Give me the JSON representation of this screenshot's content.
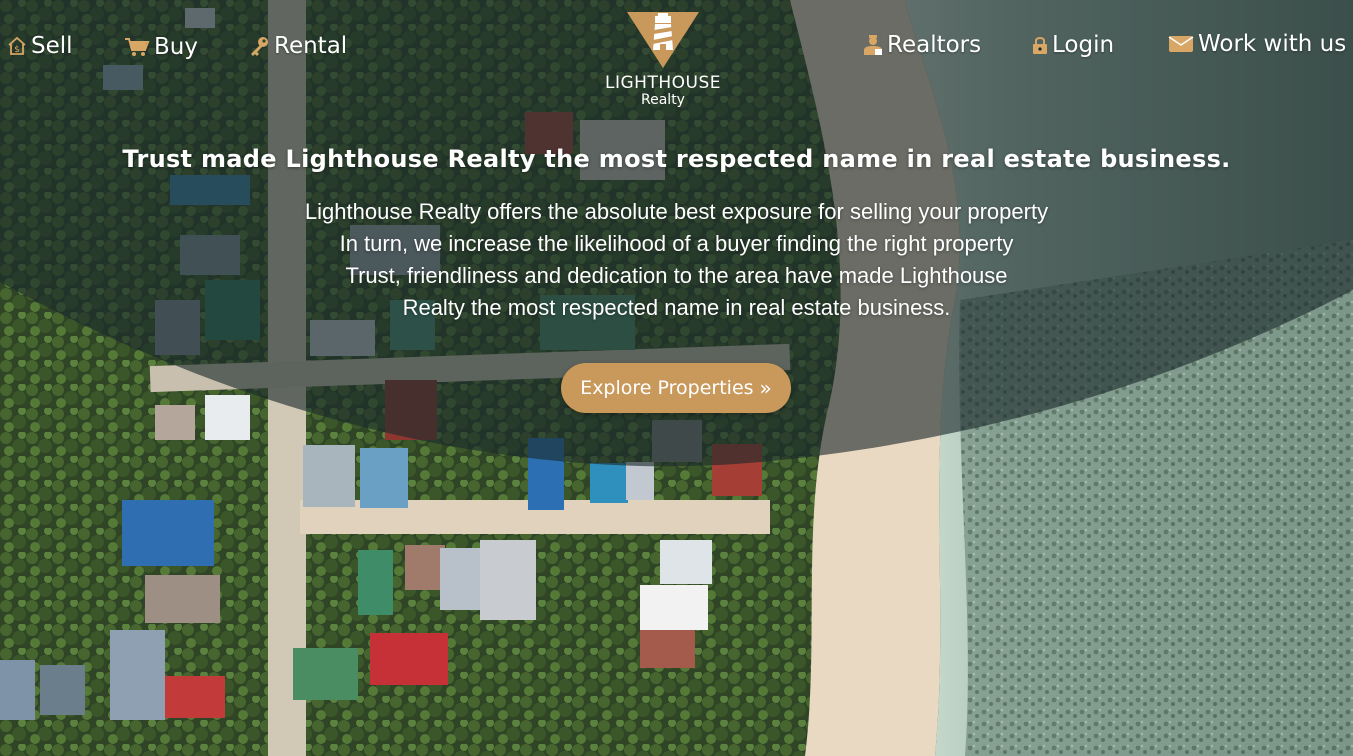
{
  "nav": {
    "sell": {
      "label": "Sell",
      "icon": "house-dollar-icon"
    },
    "buy": {
      "label": "Buy",
      "icon": "cart-icon"
    },
    "rental": {
      "label": "Rental",
      "icon": "key-icon"
    },
    "realtors": {
      "label": "Realtors",
      "icon": "realtor-icon"
    },
    "login": {
      "label": "Login",
      "icon": "lock-icon"
    },
    "work": {
      "label": "Work with us",
      "icon": "envelope-icon"
    }
  },
  "logo": {
    "brand": "LIGHTHOUSE",
    "sub": "Realty",
    "icon": "lighthouse-icon"
  },
  "hero": {
    "title": "Trust made Lighthouse Realty the most respected name in real estate business.",
    "lines": [
      "Lighthouse Realty offers the absolute best exposure for selling your property",
      "In turn, we increase the likelihood of a buyer finding the right property",
      "Trust, friendliness and dedication to the area have made Lighthouse",
      "Realty the most respected name in real estate business."
    ],
    "cta_label": "Explore Properties",
    "cta_icon": "double-chevron-right-icon"
  },
  "colors": {
    "accent": "#c9995c",
    "icon_gold": "#d9a765",
    "overlay": "#1c2a2c",
    "text": "#ffffff"
  }
}
